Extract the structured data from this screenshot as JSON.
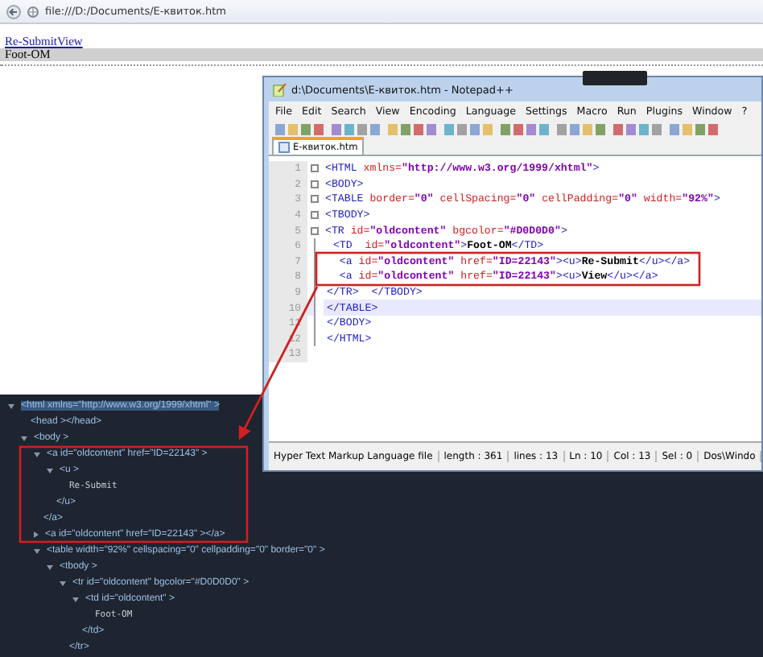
{
  "browser": {
    "url": "file:///D:/Documents/E-квиток.htm"
  },
  "page": {
    "links": [
      "Re-Submit",
      "View"
    ],
    "cell": "Foot-OM"
  },
  "editor_window": {
    "title": "d:\\Documents\\E-квиток.htm - Notepad++",
    "menu": [
      "File",
      "Edit",
      "Search",
      "View",
      "Encoding",
      "Language",
      "Settings",
      "Macro",
      "Run",
      "Plugins",
      "Window",
      "?"
    ],
    "tabs": [
      {
        "label": "E-квиток.htm",
        "selected": true
      }
    ],
    "lines": [
      {
        "number": "1",
        "foldable": true,
        "current": false,
        "tokens": [
          {
            "kind": "tag",
            "text": "<HTML "
          },
          {
            "kind": "attr",
            "text": "xmlns="
          },
          {
            "kind": "value",
            "text": "\"http://www.w3.org/1999/xhtml\""
          },
          {
            "kind": "tag",
            "text": ">"
          }
        ]
      },
      {
        "number": "2",
        "foldable": true,
        "current": false,
        "tokens": [
          {
            "kind": "tag",
            "text": "<BODY>"
          }
        ]
      },
      {
        "number": "3",
        "foldable": true,
        "current": false,
        "tokens": [
          {
            "kind": "tag",
            "text": "<TABLE "
          },
          {
            "kind": "attr",
            "text": "border="
          },
          {
            "kind": "value",
            "text": "\"0\""
          },
          {
            "kind": "attr",
            "text": " cellSpacing="
          },
          {
            "kind": "value",
            "text": "\"0\""
          },
          {
            "kind": "attr",
            "text": " cellPadding="
          },
          {
            "kind": "value",
            "text": "\"0\""
          },
          {
            "kind": "attr",
            "text": " width="
          },
          {
            "kind": "value",
            "text": "\"92%\""
          },
          {
            "kind": "tag",
            "text": ">"
          }
        ]
      },
      {
        "number": "4",
        "foldable": true,
        "current": false,
        "tokens": [
          {
            "kind": "tag",
            "text": "<TBODY>"
          }
        ]
      },
      {
        "number": "5",
        "foldable": true,
        "current": false,
        "tokens": [
          {
            "kind": "tag",
            "text": "<TR "
          },
          {
            "kind": "attr",
            "text": "id="
          },
          {
            "kind": "value",
            "text": "\"oldcontent\""
          },
          {
            "kind": "attr",
            "text": " bgcolor="
          },
          {
            "kind": "value",
            "text": "\"#D0D0D0\""
          },
          {
            "kind": "tag",
            "text": ">"
          }
        ]
      },
      {
        "number": "6",
        "foldable": false,
        "current": false,
        "tokens": [
          {
            "kind": "tag",
            "text": " <TD  "
          },
          {
            "kind": "attr",
            "text": "id="
          },
          {
            "kind": "value",
            "text": "\"oldcontent\""
          },
          {
            "kind": "tag",
            "text": ">"
          },
          {
            "kind": "text",
            "text": "Foot-OM"
          },
          {
            "kind": "tag",
            "text": "</TD>"
          }
        ]
      },
      {
        "number": "7",
        "foldable": false,
        "current": false,
        "tokens": [
          {
            "kind": "tag",
            "text": "  <a "
          },
          {
            "kind": "attr",
            "text": "id="
          },
          {
            "kind": "value",
            "text": "\"oldcontent\""
          },
          {
            "kind": "attr",
            "text": " href="
          },
          {
            "kind": "value",
            "text": "\"ID=22143\""
          },
          {
            "kind": "tag",
            "text": "><u>"
          },
          {
            "kind": "text",
            "text": "Re-Submit"
          },
          {
            "kind": "tag",
            "text": "</u></a>"
          }
        ]
      },
      {
        "number": "8",
        "foldable": false,
        "current": false,
        "tokens": [
          {
            "kind": "tag",
            "text": "  <a "
          },
          {
            "kind": "attr",
            "text": "id="
          },
          {
            "kind": "value",
            "text": "\"oldcontent\""
          },
          {
            "kind": "attr",
            "text": " href="
          },
          {
            "kind": "value",
            "text": "\"ID=22143\""
          },
          {
            "kind": "tag",
            "text": "><u>"
          },
          {
            "kind": "text",
            "text": "View"
          },
          {
            "kind": "tag",
            "text": "</u></a>"
          }
        ]
      },
      {
        "number": "9",
        "foldable": false,
        "current": false,
        "tokens": [
          {
            "kind": "tag",
            "text": "</TR>  </TBODY>"
          }
        ]
      },
      {
        "number": "10",
        "foldable": false,
        "current": true,
        "tokens": [
          {
            "kind": "tag",
            "text": "</TABLE>"
          }
        ]
      },
      {
        "number": "11",
        "foldable": false,
        "current": false,
        "tokens": [
          {
            "kind": "tag",
            "text": "</BODY>"
          }
        ]
      },
      {
        "number": "12",
        "foldable": false,
        "current": false,
        "tokens": [
          {
            "kind": "tag",
            "text": "</HTML>"
          }
        ]
      },
      {
        "number": "13",
        "foldable": false,
        "current": false
      }
    ],
    "status_bar": [
      "Hyper Text Markup Language file",
      "length : 361",
      "lines : 13",
      "Ln : 10",
      "Col : 13",
      "Sel : 0",
      "Dos\\Windo"
    ]
  },
  "devtools": {
    "tree": [
      {
        "text": "<html xmlns=\"http://www.w3.org/1999/xhtml\"  >",
        "expanded": true,
        "selected": true,
        "children": [
          {
            "text": "<head  ></head>",
            "selected": false
          },
          {
            "text": "<body  >",
            "expanded": true,
            "selected": false,
            "children": [
              {
                "text": "<a id=\"oldcontent\" href=\"ID=22143\"  >",
                "expanded": true,
                "selected": false,
                "close": "</a>",
                "children": [
                  {
                    "text": "<u  >",
                    "expanded": true,
                    "selected": false,
                    "close": "</u>",
                    "children": [
                      {
                        "text": "Re-Submit",
                        "selected": false,
                        "kind": "text"
                      }
                    ]
                  }
                ]
              },
              {
                "text": "<a id=\"oldcontent\" href=\"ID=22143\"  ></a>",
                "expanded": false,
                "selected": false
              },
              {
                "text": "<table width=\"92%\" cellspacing=\"0\" cellpadding=\"0\" border=\"0\"  >",
                "expanded": true,
                "selected": false,
                "children": [
                  {
                    "text": "<tbody  >",
                    "expanded": true,
                    "selected": false,
                    "children": [
                      {
                        "text": "<tr id=\"oldcontent\" bgcolor=\"#D0D0D0\"  >",
                        "expanded": true,
                        "selected": false,
                        "close": "</tr>",
                        "children": [
                          {
                            "text": "<td id=\"oldcontent\"  >",
                            "expanded": true,
                            "selected": false,
                            "close": "</td>",
                            "children": [
                              {
                                "text": "Foot-OM",
                                "selected": false,
                                "kind": "text"
                              }
                            ]
                          }
                        ]
                      }
                    ]
                  }
                ]
              }
            ]
          }
        ]
      }
    ]
  }
}
